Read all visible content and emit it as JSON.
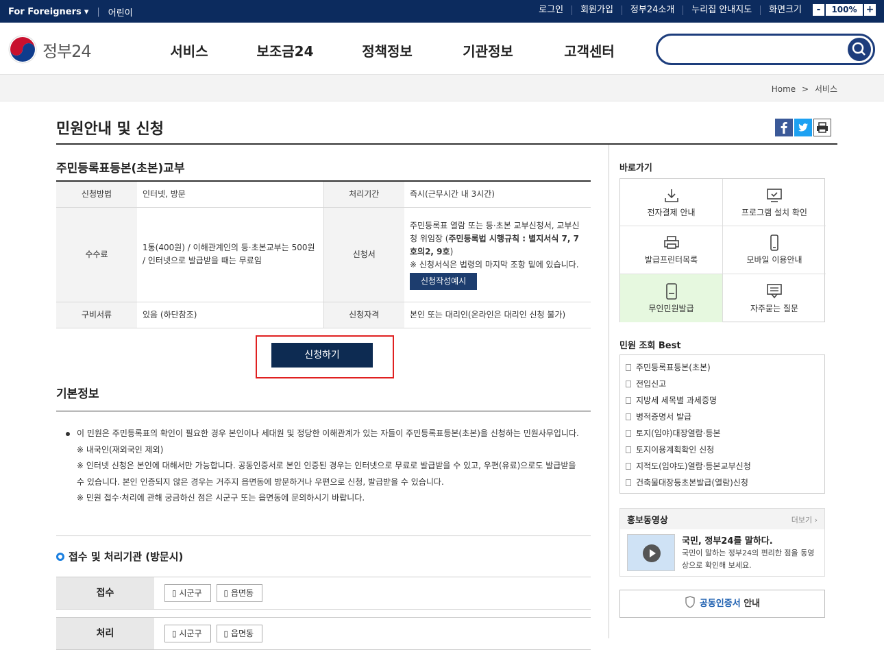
{
  "topbar": {
    "foreign": "For Foreigners",
    "kids": "어린이",
    "links": [
      "로그인",
      "회원가입",
      "정부24소개",
      "누리집 안내지도"
    ],
    "screen_size": "화면크기",
    "zoom_minus": "-",
    "zoom_value": "100%",
    "zoom_plus": "+"
  },
  "header": {
    "logo_text": "정부24",
    "nav": [
      "서비스",
      "보조금24",
      "정책정보",
      "기관정보",
      "고객센터"
    ],
    "search_value": ""
  },
  "breadcrumb": {
    "home": "Home",
    "sep": ">",
    "current": "서비스"
  },
  "page": {
    "title": "민원안내 및 신청"
  },
  "service": {
    "title": "주민등록표등본(초본)교부",
    "rows": {
      "method_label": "신청방법",
      "method_value": "인터넷, 방문",
      "period_label": "처리기간",
      "period_value": "즉시(근무시간 내 3시간)",
      "fee_label": "수수료",
      "fee_value": "1통(400원) / 이해관계인의 등·초본교부는 500원 / 인터넷으로 발급받을 때는 무료임",
      "form_label": "신청서",
      "form_value_1": "주민등록표 열람 또는 등·초본 교부신청서, 교부신청 위임장 (",
      "form_value_bold": "주민등록법 시행규칙 : 별지서식 7, 7호의2, 9호",
      "form_value_2": ")",
      "form_value_note": "※ 신청서식은 법령의 마지막 조항 밑에 있습니다.",
      "form_button": "신청작성예시",
      "docs_label": "구비서류",
      "docs_value": "있음 (하단참조)",
      "qual_label": "신청자격",
      "qual_value": "본인 또는 대리인(온라인은 대리인 신청 불가)"
    },
    "apply_button": "신청하기"
  },
  "basic": {
    "title": "기본정보",
    "bullet": "이 민원은 주민등록표의 확인이 필요한 경우 본인이나 세대원 및 정당한 이해관계가 있는 자들이 주민등록표등본(초본)을 신청하는 민원사무입니다.",
    "notes": [
      "※ 내국인(재외국인 제외)",
      "※ 인터넷 신청은 본인에 대해서만 가능합니다. 공동인증서로 본인 인증된 경우는 인터넷으로 무료로 발급받을 수 있고, 우편(유료)으로도 발급받을 수 있습니다. 본인 인증되지 않은 경우는 거주지 읍면동에 방문하거나 우편으로 신청, 발급받을 수 있습니다.",
      "※ 민원 접수·처리에 관해 궁금하신 점은 시군구 또는 읍면동에 문의하시기 바랍니다."
    ]
  },
  "org": {
    "title": "접수 및 처리기관 (방문시)",
    "receive_label": "접수",
    "process_label": "처리",
    "chip1": "시군구",
    "chip2": "읍면동"
  },
  "sidebar": {
    "shortcut_title": "바로가기",
    "shortcuts": [
      "전자결제 안내",
      "프로그램 설치 확인",
      "발급프린터목록",
      "모바일 이용안내",
      "무인민원발급",
      "자주묻는 질문"
    ],
    "best_title": "민원 조회 Best",
    "best": [
      "주민등록표등본(초본)",
      "전입신고",
      "지방세 세목별 과세증명",
      "병적증명서 발급",
      "토지(임야)대장열람·등본",
      "토지이용계획확인 신청",
      "지적도(임야도)열람·등본교부신청",
      "건축물대장등초본발급(열람)신청"
    ],
    "promo_title": "홍보동영상",
    "promo_more": "더보기 ›",
    "promo_head": "국민, 정부24를 말하다.",
    "promo_desc": "국민이 말하는 정부24의 편리한 점을 동영상으로 확인해 보세요.",
    "cert_bold": "공동인증서",
    "cert_rest": " 안내"
  },
  "colors": {
    "navy": "#0c2b5e",
    "accent": "#1d3d7c",
    "highlight": "#e6f8df",
    "alert": "#e02020"
  }
}
